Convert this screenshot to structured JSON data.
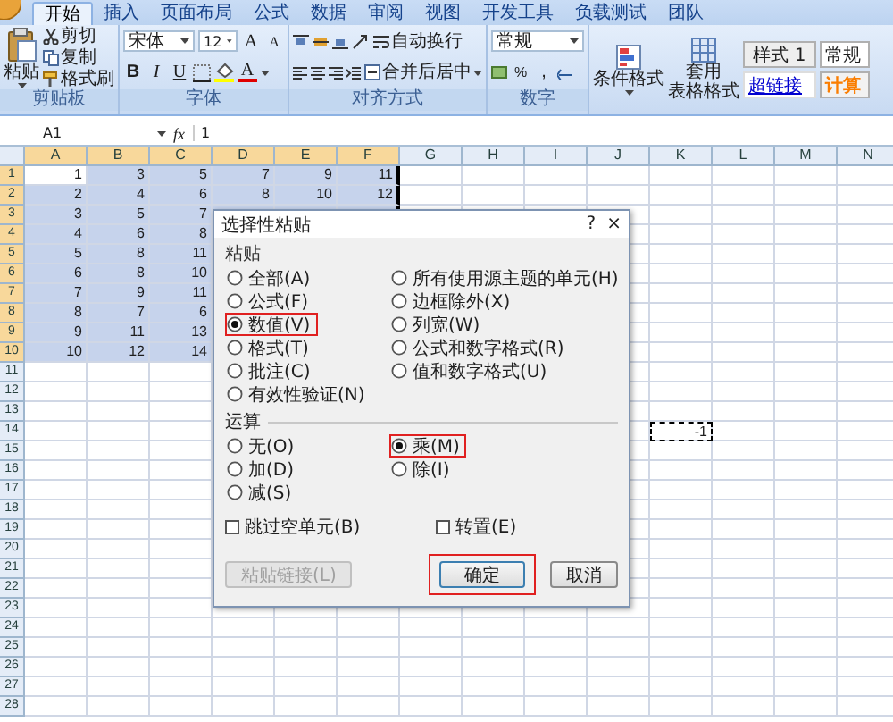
{
  "ribbon": {
    "tabs": [
      {
        "label": "开始",
        "selected": true
      },
      {
        "label": "插入",
        "selected": false
      },
      {
        "label": "页面布局",
        "selected": false
      },
      {
        "label": "公式",
        "selected": false
      },
      {
        "label": "数据",
        "selected": false
      },
      {
        "label": "审阅",
        "selected": false
      },
      {
        "label": "视图",
        "selected": false
      },
      {
        "label": "开发工具",
        "selected": false
      },
      {
        "label": "负载测试",
        "selected": false
      },
      {
        "label": "团队",
        "selected": false
      }
    ],
    "clipboard": {
      "paste": "粘贴",
      "cut": "剪切",
      "copy": "复制",
      "format_painter": "格式刷",
      "label": "剪贴板"
    },
    "font": {
      "name": "宋体",
      "size": "12",
      "grow": "A",
      "shrink": "A",
      "bold": "B",
      "italic": "I",
      "underline": "U",
      "font_color": "A",
      "label": "字体"
    },
    "alignment": {
      "wrap": "自动换行",
      "merge": "合并后居中",
      "label": "对齐方式"
    },
    "number": {
      "format": "常规",
      "percent": "%",
      "comma": ",",
      "label": "数字"
    },
    "styles": {
      "conditional": "条件格式",
      "table_line1": "套用",
      "table_line2": "表格格式",
      "cells": [
        {
          "label": "样式 1",
          "kind": "plain"
        },
        {
          "label": "常规",
          "kind": "normal"
        },
        {
          "label": "超链接",
          "kind": "link"
        },
        {
          "label": "计算",
          "kind": "calc"
        }
      ]
    }
  },
  "formula_bar": {
    "cell": "A1",
    "fx": "fx",
    "value": "1"
  },
  "sheet": {
    "columns": [
      {
        "label": "A",
        "selected": true
      },
      {
        "label": "B",
        "selected": true
      },
      {
        "label": "C",
        "selected": true
      },
      {
        "label": "D",
        "selected": true
      },
      {
        "label": "E",
        "selected": true
      },
      {
        "label": "F",
        "selected": true
      },
      {
        "label": "G",
        "selected": false
      },
      {
        "label": "H",
        "selected": false
      },
      {
        "label": "I",
        "selected": false
      },
      {
        "label": "J",
        "selected": false
      },
      {
        "label": "K",
        "selected": false
      },
      {
        "label": "L",
        "selected": false
      },
      {
        "label": "M",
        "selected": false
      },
      {
        "label": "N",
        "selected": false
      }
    ],
    "rows": [
      {
        "number": "1",
        "selected": true,
        "cells": [
          "1",
          "3",
          "5",
          "7",
          "9",
          "11"
        ]
      },
      {
        "number": "2",
        "selected": true,
        "cells": [
          "2",
          "4",
          "6",
          "8",
          "10",
          "12"
        ]
      },
      {
        "number": "3",
        "selected": true,
        "cells": [
          "3",
          "5",
          "7"
        ]
      },
      {
        "number": "4",
        "selected": true,
        "cells": [
          "4",
          "6",
          "8"
        ]
      },
      {
        "number": "5",
        "selected": true,
        "cells": [
          "5",
          "8",
          "11"
        ]
      },
      {
        "number": "6",
        "selected": true,
        "cells": [
          "6",
          "8",
          "10"
        ]
      },
      {
        "number": "7",
        "selected": true,
        "cells": [
          "7",
          "9",
          "11"
        ]
      },
      {
        "number": "8",
        "selected": true,
        "cells": [
          "8",
          "7",
          "6"
        ]
      },
      {
        "number": "9",
        "selected": true,
        "cells": [
          "9",
          "11",
          "13"
        ]
      },
      {
        "number": "10",
        "selected": true,
        "cells": [
          "10",
          "12",
          "14"
        ]
      },
      {
        "number": "11",
        "selected": false
      },
      {
        "number": "12",
        "selected": false
      },
      {
        "number": "13",
        "selected": false
      },
      {
        "number": "14",
        "selected": false
      },
      {
        "number": "15",
        "selected": false
      },
      {
        "number": "16",
        "selected": false
      },
      {
        "number": "17",
        "selected": false
      },
      {
        "number": "18",
        "selected": false
      },
      {
        "number": "19",
        "selected": false
      },
      {
        "number": "20",
        "selected": false
      },
      {
        "number": "21",
        "selected": false
      },
      {
        "number": "22",
        "selected": false
      },
      {
        "number": "23",
        "selected": false
      },
      {
        "number": "24",
        "selected": false
      },
      {
        "number": "25",
        "selected": false
      },
      {
        "number": "26",
        "selected": false
      },
      {
        "number": "27",
        "selected": false
      },
      {
        "number": "28",
        "selected": false
      }
    ],
    "copied_cell": {
      "value": "-1"
    }
  },
  "dialog": {
    "title": "选择性粘贴",
    "help": "?",
    "close": "×",
    "paste_label": "粘贴",
    "paste_options": {
      "left": [
        {
          "label": "全部(A)",
          "selected": false,
          "highlighted": false
        },
        {
          "label": "公式(F)",
          "selected": false,
          "highlighted": false
        },
        {
          "label": "数值(V)",
          "selected": true,
          "highlighted": true
        },
        {
          "label": "格式(T)",
          "selected": false,
          "highlighted": false
        },
        {
          "label": "批注(C)",
          "selected": false,
          "highlighted": false
        },
        {
          "label": "有效性验证(N)",
          "selected": false,
          "highlighted": false
        }
      ],
      "right": [
        {
          "label": "所有使用源主题的单元(H)",
          "selected": false,
          "highlighted": false
        },
        {
          "label": "边框除外(X)",
          "selected": false,
          "highlighted": false
        },
        {
          "label": "列宽(W)",
          "selected": false,
          "highlighted": false
        },
        {
          "label": "公式和数字格式(R)",
          "selected": false,
          "highlighted": false
        },
        {
          "label": "值和数字格式(U)",
          "selected": false,
          "highlighted": false
        }
      ]
    },
    "operation_label": "运算",
    "operations": {
      "left": [
        {
          "label": "无(O)",
          "selected": false,
          "highlighted": false
        },
        {
          "label": "加(D)",
          "selected": false,
          "highlighted": false
        },
        {
          "label": "减(S)",
          "selected": false,
          "highlighted": false
        }
      ],
      "right": [
        {
          "label": "乘(M)",
          "selected": true,
          "highlighted": true
        },
        {
          "label": "除(I)",
          "selected": false,
          "highlighted": false
        }
      ]
    },
    "checkboxes": [
      {
        "label": "跳过空单元(B)",
        "checked": false
      },
      {
        "label": "转置(E)",
        "checked": false
      }
    ],
    "buttons": [
      {
        "label": "粘贴链接(L)",
        "disabled": true,
        "highlighted": false
      },
      {
        "label": "确定",
        "disabled": false,
        "highlighted": true
      },
      {
        "label": "取消",
        "disabled": false,
        "highlighted": false
      }
    ]
  }
}
